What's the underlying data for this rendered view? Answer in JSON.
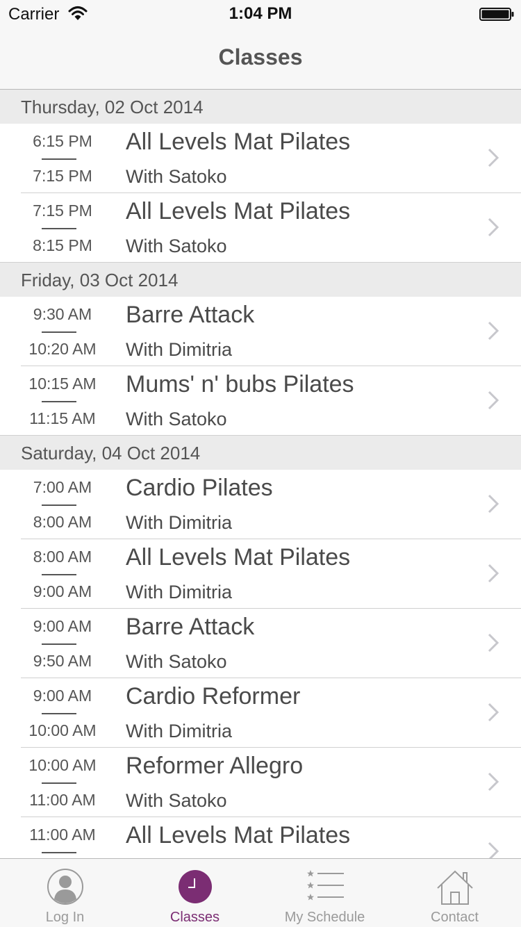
{
  "status_bar": {
    "carrier": "Carrier",
    "time": "1:04 PM",
    "icons": [
      "wifi-icon",
      "battery-icon"
    ]
  },
  "nav": {
    "title": "Classes"
  },
  "sections": [
    {
      "header": "Thursday, 02 Oct 2014",
      "rows": [
        {
          "start": "6:15 PM",
          "end": "7:15 PM",
          "name": "All Levels Mat Pilates",
          "instructor": "With Satoko"
        },
        {
          "start": "7:15 PM",
          "end": "8:15 PM",
          "name": "All Levels Mat Pilates",
          "instructor": "With Satoko"
        }
      ]
    },
    {
      "header": "Friday, 03 Oct 2014",
      "rows": [
        {
          "start": "9:30 AM",
          "end": "10:20 AM",
          "name": "Barre Attack",
          "instructor": "With Dimitria"
        },
        {
          "start": "10:15 AM",
          "end": "11:15 AM",
          "name": "Mums' n' bubs Pilates",
          "instructor": "With Satoko"
        }
      ]
    },
    {
      "header": "Saturday, 04 Oct 2014",
      "rows": [
        {
          "start": "7:00 AM",
          "end": "8:00 AM",
          "name": "Cardio Pilates",
          "instructor": "With Dimitria"
        },
        {
          "start": "8:00 AM",
          "end": "9:00 AM",
          "name": "All Levels Mat Pilates",
          "instructor": "With Dimitria"
        },
        {
          "start": "9:00 AM",
          "end": "9:50 AM",
          "name": "Barre Attack",
          "instructor": "With Satoko"
        },
        {
          "start": "9:00 AM",
          "end": "10:00 AM",
          "name": "Cardio Reformer",
          "instructor": "With Dimitria"
        },
        {
          "start": "10:00 AM",
          "end": "11:00 AM",
          "name": "Reformer Allegro",
          "instructor": "With Satoko"
        },
        {
          "start": "11:00 AM",
          "end": "",
          "name": "All Levels Mat Pilates",
          "instructor": ""
        }
      ]
    }
  ],
  "tabs": [
    {
      "label": "Log In",
      "icon": "user-icon",
      "active": false
    },
    {
      "label": "Classes",
      "icon": "clock-icon",
      "active": true
    },
    {
      "label": "My Schedule",
      "icon": "schedule-list-icon",
      "active": false
    },
    {
      "label": "Contact",
      "icon": "home-icon",
      "active": false
    }
  ],
  "colors": {
    "accent": "#7b2d73",
    "section_bg": "#ebebeb",
    "bar_bg": "#f7f7f7",
    "text": "#4a4a4a",
    "inactive_tab": "#9a9a9a"
  }
}
